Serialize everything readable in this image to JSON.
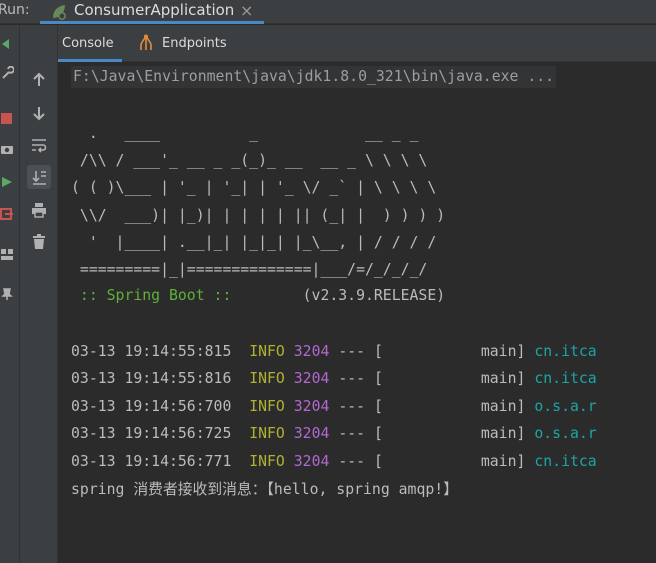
{
  "run_bar": {
    "label": "Run:",
    "tab_title": "ConsumerApplication",
    "close_glyph": "×"
  },
  "subtabs": [
    {
      "label": "Console",
      "icon": "console-icon",
      "active": true
    },
    {
      "label": "Endpoints",
      "icon": "endpoints-icon",
      "active": false
    }
  ],
  "toolbar": [
    "arrow-up-icon",
    "arrow-down-icon",
    "soft-wrap-icon",
    "scroll-to-end-icon",
    "print-icon",
    "trash-icon"
  ],
  "console": {
    "command": "F:\\Java\\Environment\\java\\jdk1.8.0_321\\bin\\java.exe ...",
    "banner": "  .   ____          _            __ _ _\n /\\\\ / ___'_ __ _ _(_)_ __  __ _ \\ \\ \\ \\\n( ( )\\___ | '_ | '_| | '_ \\/ _` | \\ \\ \\ \\\n \\\\/  ___)| |_)| | | | | || (_| |  ) ) ) )\n  '  |____| .__|_| |_|_| |_\\__, | / / / /\n =========|_|==============|___/=/_/_/_/",
    "spring_label": " :: Spring Boot :: ",
    "spring_version": "       (v2.3.9.RELEASE)",
    "logs": [
      {
        "ts": "03-13 19:14:55:815",
        "level": "INFO",
        "pid": "3204",
        "sep": "---",
        "thread": "[           main]",
        "logger": "cn.itca"
      },
      {
        "ts": "03-13 19:14:55:816",
        "level": "INFO",
        "pid": "3204",
        "sep": "---",
        "thread": "[           main]",
        "logger": "cn.itca"
      },
      {
        "ts": "03-13 19:14:56:700",
        "level": "INFO",
        "pid": "3204",
        "sep": "---",
        "thread": "[           main]",
        "logger": "o.s.a.r"
      },
      {
        "ts": "03-13 19:14:56:725",
        "level": "INFO",
        "pid": "3204",
        "sep": "---",
        "thread": "[           main]",
        "logger": "o.s.a.r"
      },
      {
        "ts": "03-13 19:14:56:771",
        "level": "INFO",
        "pid": "3204",
        "sep": "---",
        "thread": "[           main]",
        "logger": "cn.itca"
      }
    ],
    "message": "spring 消费者接收到消息：【hello, spring amqp!】"
  },
  "colors": {
    "background": "#2b2b2b",
    "panel": "#3c3f41",
    "accent": "#4a88c7",
    "info": "#b2b032",
    "pid": "#b268d2",
    "logger": "#1ca5a5",
    "spring": "#5faf3a"
  }
}
